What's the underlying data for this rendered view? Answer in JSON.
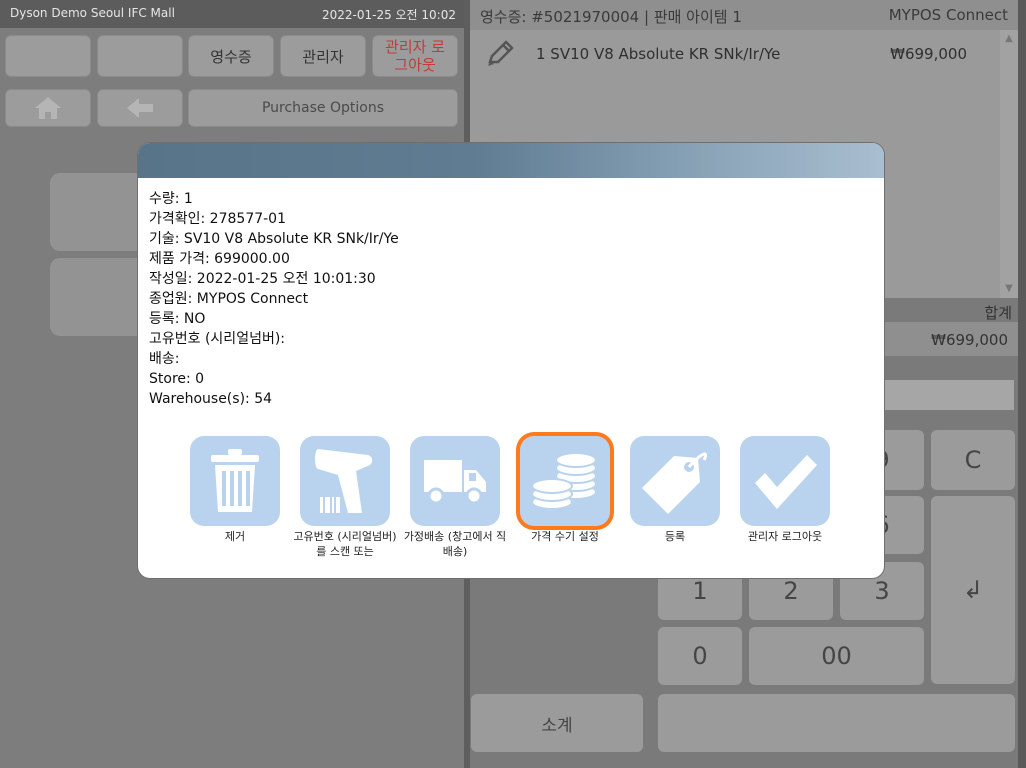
{
  "titlebar": {
    "store": "Dyson Demo Seoul IFC Mall",
    "clock": "2022-01-25 오전 10:02"
  },
  "top_buttons": {
    "receipt": "영수증",
    "manager": "관리자",
    "manager_logout": "관리자 로그아웃"
  },
  "nav": {
    "purchase_options": "Purchase Options"
  },
  "receipt": {
    "header": "영수증: #5021970004 | 판매 아이템 1",
    "brand": "MYPOS Connect",
    "item_name": "1 SV10 V8 Absolute KR SNk/Ir/Ye",
    "item_price": "₩699,000",
    "total_label": "합계",
    "total_amount": "₩699,000"
  },
  "keypad": {
    "k9": "9",
    "kC": "C",
    "k6": "6",
    "k1": "1",
    "k2": "2",
    "k3": "3",
    "k0": "0",
    "k00": "00",
    "enter": "↲"
  },
  "subtotal": "소계",
  "modal": {
    "details": [
      "수량: 1",
      "가격확인: 278577-01",
      "기술: SV10 V8 Absolute KR SNk/Ir/Ye",
      "제품 가격: 699000.00",
      "작성일: 2022-01-25 오전 10:01:30",
      "종업원: MYPOS Connect",
      "등록:  NO",
      "고유번호 (시리얼넘버):",
      "배송:",
      "Store: 0",
      "Warehouse(s): 54"
    ],
    "actions": {
      "remove": "제거",
      "serial_scan": "고유번호 (시리얼넘버)를 스캔 또는",
      "home_delivery": "가정배송 (창고에서 직 배송)",
      "manual_price": "가격 수기 설정",
      "register": "등록",
      "manager_logout": "관리자 로그아웃"
    }
  },
  "colors": {
    "accent": "#ff7a1a",
    "icon_tile": "#b9d3ee",
    "header_gradient_start": "#587488"
  }
}
